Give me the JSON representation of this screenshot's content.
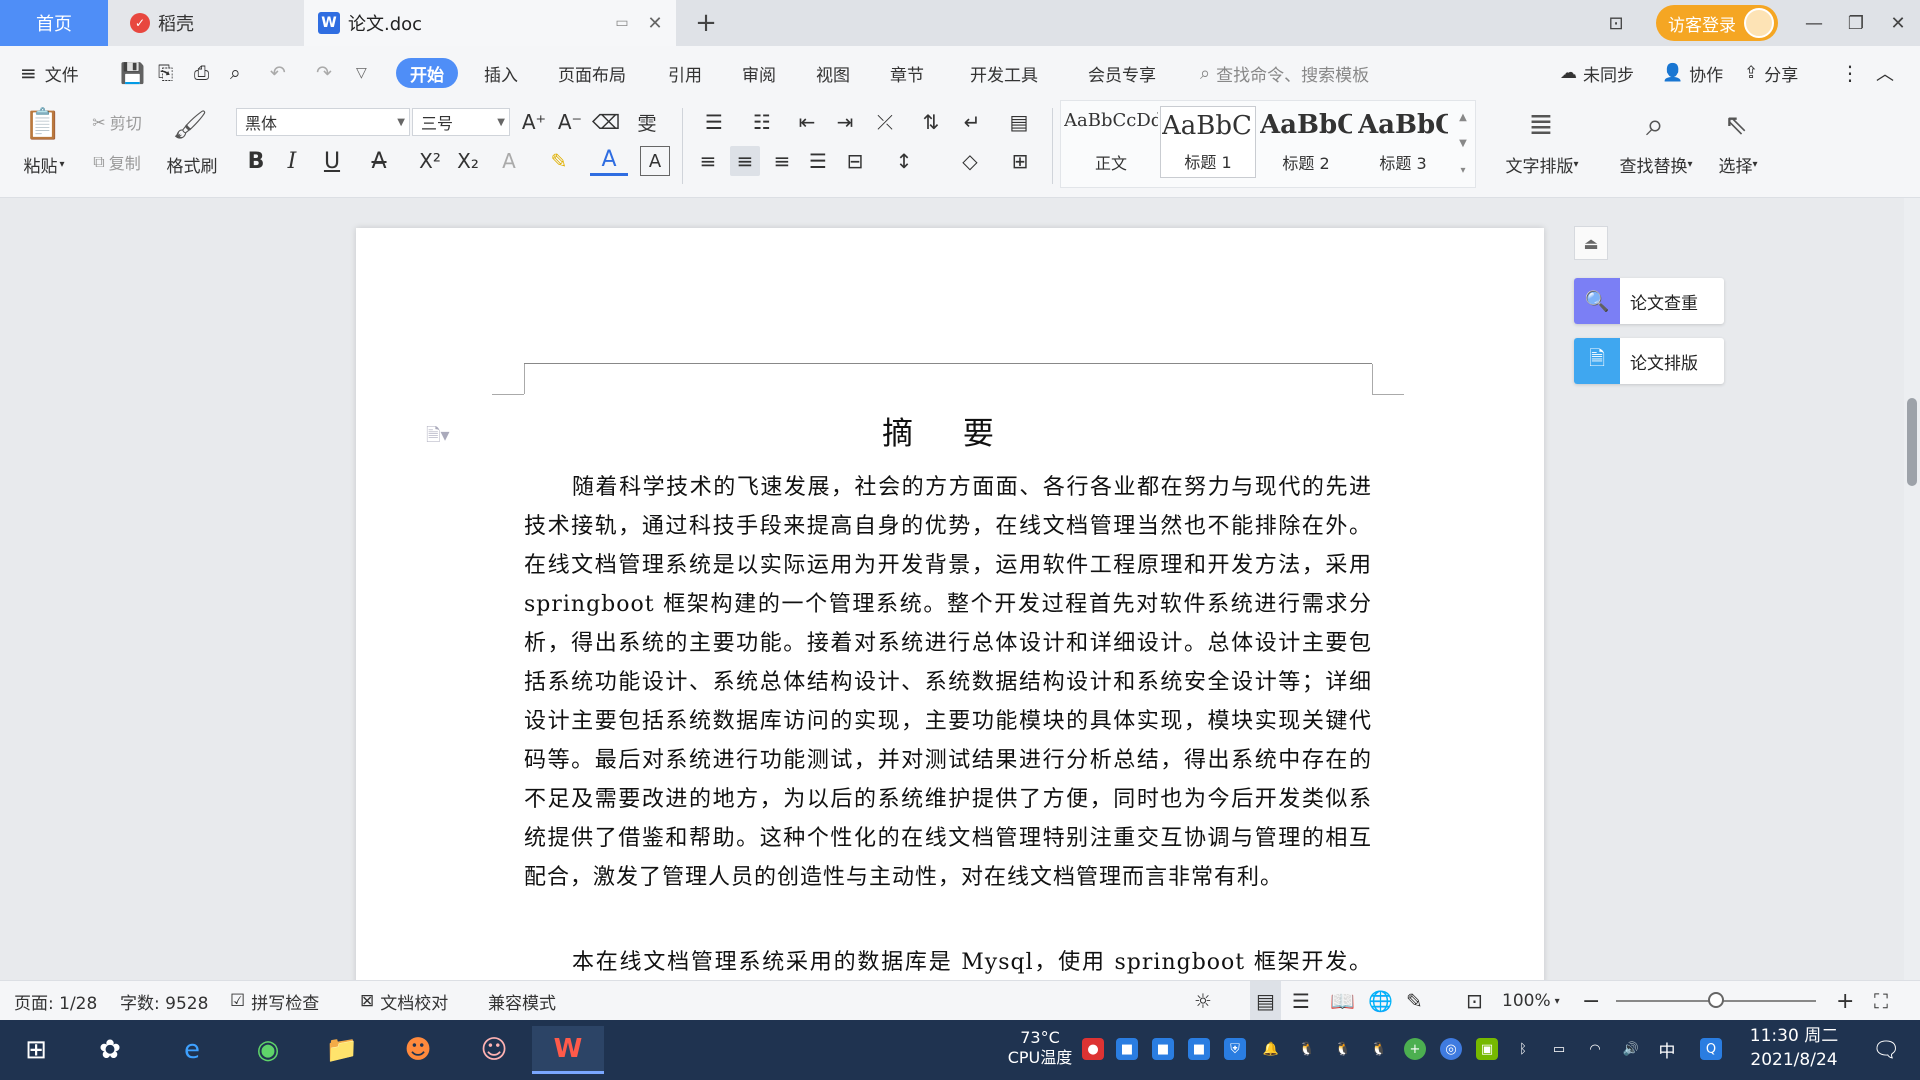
{
  "tabs": {
    "home": "首页",
    "daoke": "稻壳",
    "doc": "论文.doc",
    "add": "+"
  },
  "login": {
    "label": "访客登录"
  },
  "menu": {
    "file": "文件",
    "items": [
      "开始",
      "插入",
      "页面布局",
      "引用",
      "审阅",
      "视图",
      "章节",
      "开发工具",
      "会员专享"
    ],
    "search_placeholder": "查找命令、搜索模板",
    "sync": "未同步",
    "collab": "协作",
    "share": "分享"
  },
  "ribbon": {
    "paste": "粘贴",
    "cut": "剪切",
    "copy": "复制",
    "format_painter": "格式刷",
    "font_name": "黑体",
    "font_size": "三号",
    "styles": [
      {
        "sample": "AaBbCcDd",
        "label": "正文"
      },
      {
        "sample": "AaBbC",
        "label": "标题 1"
      },
      {
        "sample": "AaBbC",
        "label": "标题 2"
      },
      {
        "sample": "AaBbC",
        "label": "标题 3"
      }
    ],
    "text_layout": "文字排版",
    "find_replace": "查找替换",
    "select": "选择"
  },
  "document": {
    "title": "摘 要",
    "para1": "随着科学技术的飞速发展，社会的方方面面、各行各业都在努力与现代的先进技术接轨，通过科技手段来提高自身的优势，在线文档管理当然也不能排除在外。在线文档管理系统是以实际运用为开发背景，运用软件工程原理和开发方法，采用 springboot 框架构建的一个管理系统。整个开发过程首先对软件系统进行需求分析，得出系统的主要功能。接着对系统进行总体设计和详细设计。总体设计主要包括系统功能设计、系统总体结构设计、系统数据结构设计和系统安全设计等；详细设计主要包括系统数据库访问的实现，主要功能模块的具体实现，模块实现关键代码等。最后对系统进行功能测试，并对测试结果进行分析总结，得出系统中存在的不足及需要改进的地方，为以后的系统维护提供了方便，同时也为今后开发类似系统提供了借鉴和帮助。这种个性化的在线文档管理特别注重交互协调与管理的相互配合，激发了管理人员的创造性与主动性，对在线文档管理而言非常有利。",
    "para2": "本在线文档管理系统采用的数据库是 Mysql，使用 springboot 框架开发。在设"
  },
  "side": {
    "check": "论文查重",
    "layout": "论文排版"
  },
  "status": {
    "page": "页面: 1/28",
    "words": "字数: 9528",
    "spell": "拼写检查",
    "proof": "文档校对",
    "compat": "兼容模式",
    "zoom": "100%"
  },
  "taskbar": {
    "temp": "73°C",
    "cpu": "CPU温度",
    "ime": "中",
    "time": "11:30 周二",
    "date": "2021/8/24"
  },
  "colors": {
    "accent": "#4f8ef7",
    "login": "#f5a623",
    "taskbar": "#1f3350"
  }
}
